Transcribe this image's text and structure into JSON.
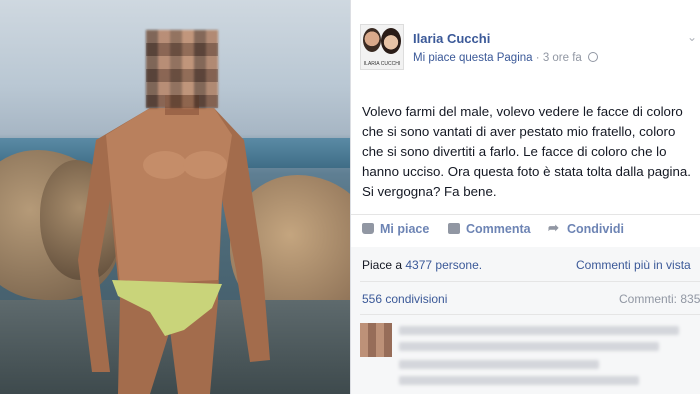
{
  "post": {
    "page_name": "Ilaria Cucchi",
    "avatar_caption": "ILARIA CUCCHI",
    "like_page_label": "Mi piace questa Pagina",
    "separator": "·",
    "time_ago": "3 ore fa",
    "text": "Volevo farmi del male, volevo vedere le facce di coloro che si sono vantati di aver pestato mio fratello, coloro che si sono divertiti a farlo. Le facce di coloro che lo hanno ucciso. Ora questa foto è stata tolta dalla pagina. Si vergogna? Fa bene."
  },
  "actions": {
    "like": "Mi piace",
    "comment": "Commenta",
    "share": "Condividi"
  },
  "stats": {
    "likes_prefix": "Piace a",
    "likes_count": "4377 persone.",
    "more_comments": "Commenti più in vista",
    "shares": "556 condivisioni",
    "comments": "Commenti: 835"
  },
  "icons": [
    "chevron-down-icon",
    "globe-icon",
    "like-icon",
    "comment-icon",
    "share-icon"
  ],
  "colors": {
    "link": "#3b5998",
    "meta": "#9197a3",
    "action": "#6d84b4",
    "panel_bg": "#f6f7f8"
  }
}
